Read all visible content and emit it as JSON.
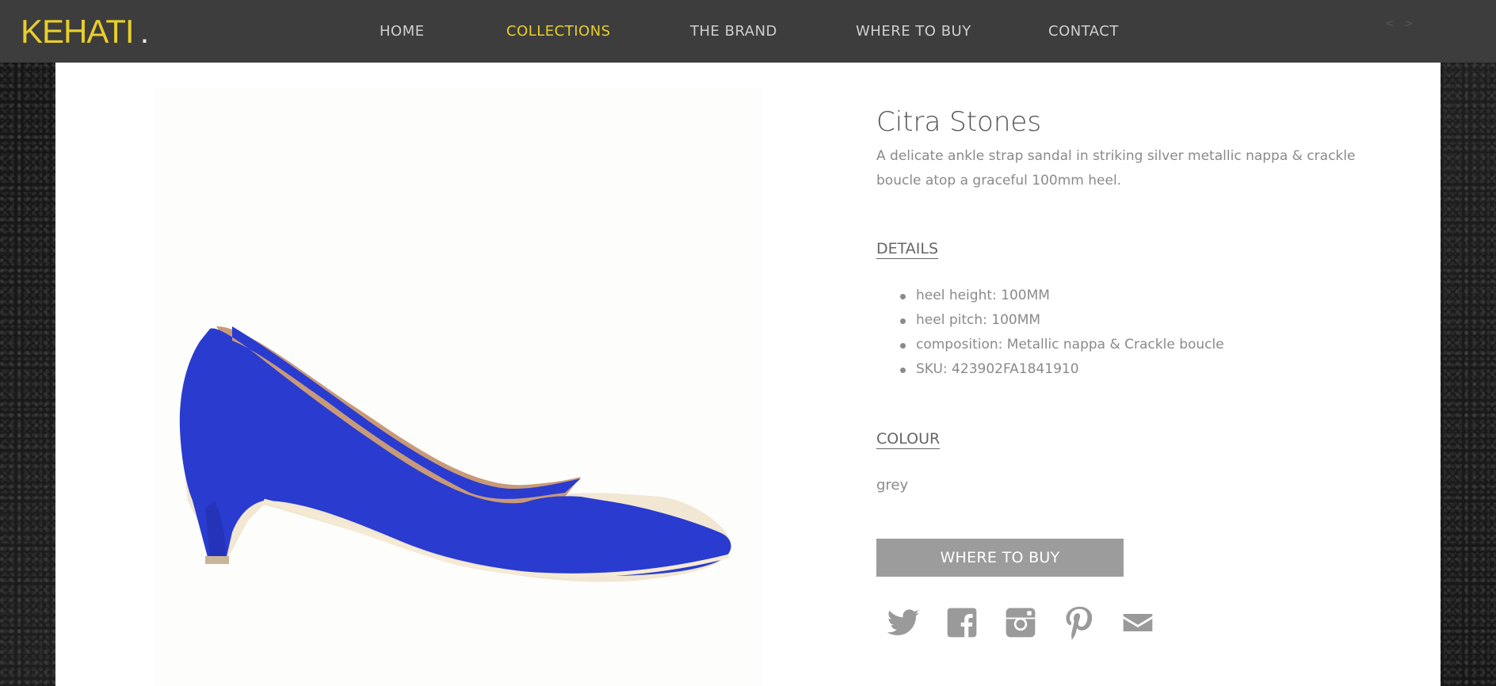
{
  "brand": {
    "name": "KEHATI",
    "dot": "."
  },
  "nav": {
    "items": [
      {
        "label": "HOME"
      },
      {
        "label": "COLLECTIONS"
      },
      {
        "label": "THE BRAND"
      },
      {
        "label": "WHERE TO BUY"
      },
      {
        "label": "CONTACT"
      }
    ],
    "pager": "< >"
  },
  "product": {
    "title": "Citra Stones",
    "description": "A delicate ankle strap sandal in striking silver metallic nappa & crackle boucle atop a graceful 100mm heel.",
    "details_heading": "DETAILS",
    "details": [
      "heel height: 100MM",
      "heel pitch: 100MM",
      "composition: Metallic nappa & Crackle boucle",
      "SKU: 423902FA1841910"
    ],
    "colour_heading": "COLOUR",
    "colour": "grey",
    "buy_label": "WHERE TO BUY",
    "image_icon": "blue-pump-shoe"
  },
  "social": [
    "twitter-icon",
    "facebook-icon",
    "instagram-icon",
    "pinterest-icon",
    "email-icon"
  ],
  "colors": {
    "accent": "#e8cf2a",
    "navbar": "#3d3d3d",
    "text_muted": "#8a8a8a",
    "button": "#9c9c9c",
    "shoe": "#2a3bd0"
  }
}
